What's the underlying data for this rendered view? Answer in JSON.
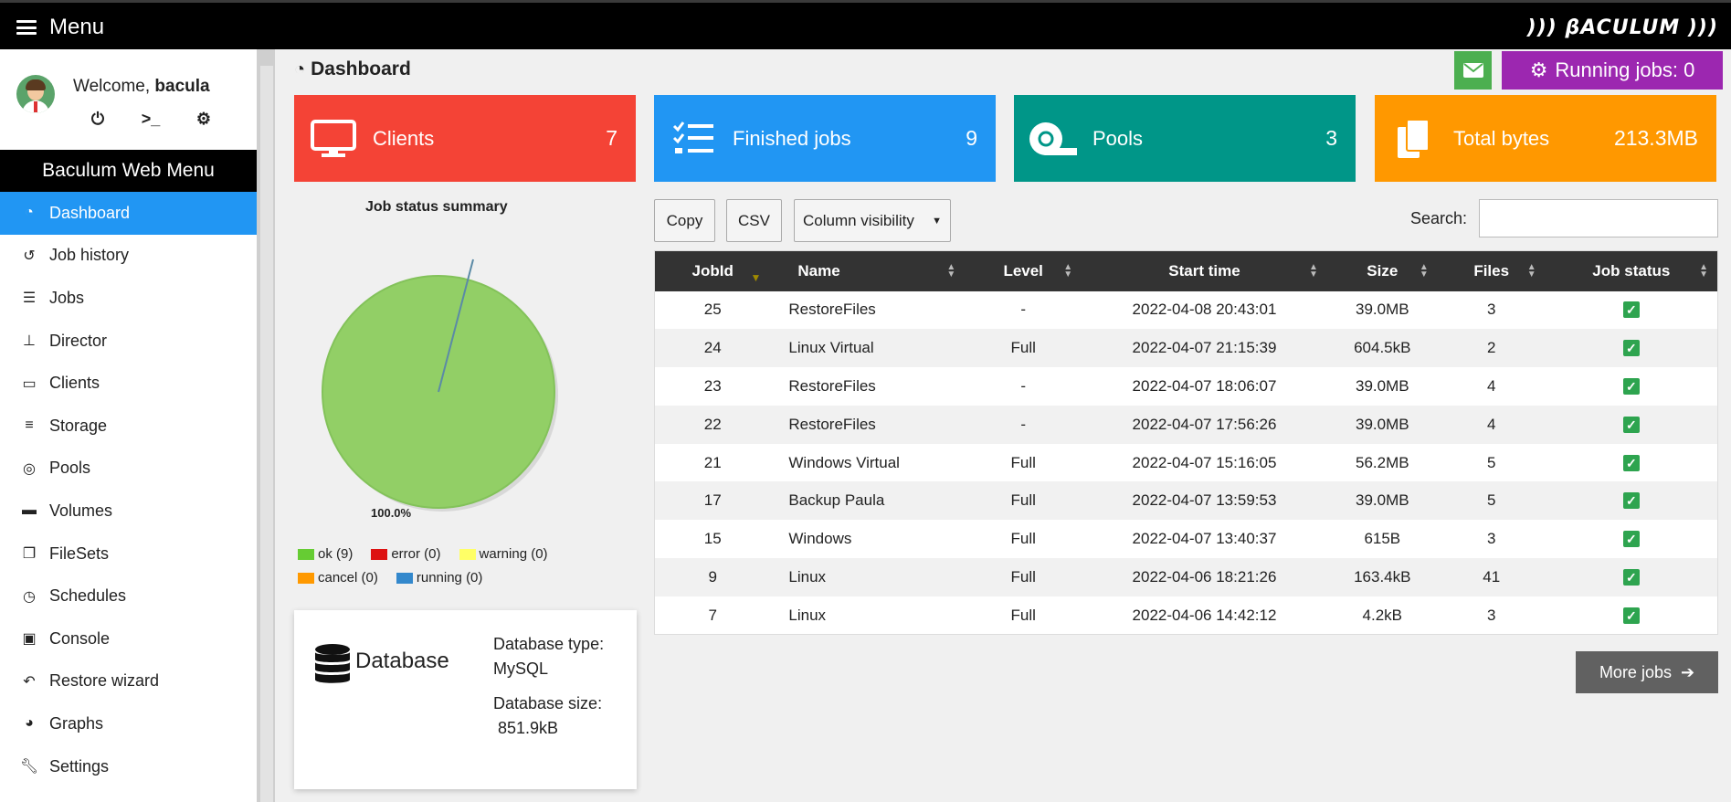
{
  "topbar": {
    "menu_label": "Menu",
    "brand": "))) βACULUM )))"
  },
  "user": {
    "welcome_prefix": "Welcome,",
    "name": "bacula"
  },
  "sidebar": {
    "header": "Baculum Web Menu",
    "items": [
      {
        "label": "Dashboard",
        "icon": "dashboard-icon"
      },
      {
        "label": "Job history",
        "icon": "history-icon"
      },
      {
        "label": "Jobs",
        "icon": "tasks-icon"
      },
      {
        "label": "Director",
        "icon": "sitemap-icon"
      },
      {
        "label": "Clients",
        "icon": "desktop-icon"
      },
      {
        "label": "Storage",
        "icon": "database-icon"
      },
      {
        "label": "Pools",
        "icon": "tape-icon"
      },
      {
        "label": "Volumes",
        "icon": "hdd-icon"
      },
      {
        "label": "FileSets",
        "icon": "copy-icon"
      },
      {
        "label": "Schedules",
        "icon": "clock-icon"
      },
      {
        "label": "Console",
        "icon": "terminal-icon"
      },
      {
        "label": "Restore wizard",
        "icon": "undo-icon"
      },
      {
        "label": "Graphs",
        "icon": "chart-pie-icon"
      },
      {
        "label": "Settings",
        "icon": "wrench-icon"
      }
    ]
  },
  "main": {
    "title": "Dashboard",
    "running_jobs_label": "Running jobs: 0"
  },
  "cards": [
    {
      "label": "Clients",
      "value": "7",
      "color": "#f44336"
    },
    {
      "label": "Finished jobs",
      "value": "9",
      "color": "#2196f3"
    },
    {
      "label": "Pools",
      "value": "3",
      "color": "#009688"
    },
    {
      "label": "Total bytes",
      "value": "213.3MB",
      "color": "#ff9800"
    }
  ],
  "job_summary": {
    "title": "Job status summary",
    "pct_label": "100.0%",
    "legend": [
      {
        "label": "ok (9)",
        "color": "#66cc33"
      },
      {
        "label": "error (0)",
        "color": "#dd1111"
      },
      {
        "label": "warning (0)",
        "color": "#ffff66"
      },
      {
        "label": "cancel (0)",
        "color": "#ff9900"
      },
      {
        "label": "running (0)",
        "color": "#3388cc"
      }
    ]
  },
  "database": {
    "title": "Database",
    "type_label": "Database type:",
    "type_value": "MySQL",
    "size_label": "Database size:",
    "size_value": "851.9kB"
  },
  "table_controls": {
    "copy": "Copy",
    "csv": "CSV",
    "column_visibility": "Column visibility",
    "search_label": "Search:",
    "search_value": ""
  },
  "jobs_table": {
    "headers": [
      "JobId",
      "Name",
      "Level",
      "Start time",
      "Size",
      "Files",
      "Job status"
    ],
    "rows": [
      [
        "25",
        "RestoreFiles",
        "-",
        "2022-04-08 20:43:01",
        "39.0MB",
        "3"
      ],
      [
        "24",
        "Linux Virtual",
        "Full",
        "2022-04-07 21:15:39",
        "604.5kB",
        "2"
      ],
      [
        "23",
        "RestoreFiles",
        "-",
        "2022-04-07 18:06:07",
        "39.0MB",
        "4"
      ],
      [
        "22",
        "RestoreFiles",
        "-",
        "2022-04-07 17:56:26",
        "39.0MB",
        "4"
      ],
      [
        "21",
        "Windows Virtual",
        "Full",
        "2022-04-07 15:16:05",
        "56.2MB",
        "5"
      ],
      [
        "17",
        "Backup Paula",
        "Full",
        "2022-04-07 13:59:53",
        "39.0MB",
        "5"
      ],
      [
        "15",
        "Windows",
        "Full",
        "2022-04-07 13:40:37",
        "615B",
        "3"
      ],
      [
        "9",
        "Linux",
        "Full",
        "2022-04-06 18:21:26",
        "163.4kB",
        "41"
      ],
      [
        "7",
        "Linux",
        "Full",
        "2022-04-06 14:42:12",
        "4.2kB",
        "3"
      ]
    ]
  },
  "more_jobs_label": "More jobs"
}
